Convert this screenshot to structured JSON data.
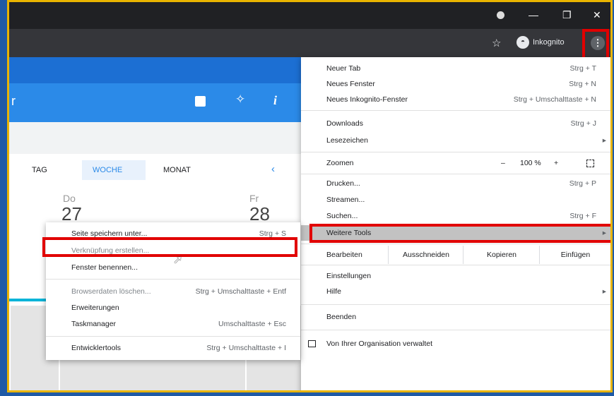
{
  "browser": {
    "incognito_label": "Inkognito",
    "window_controls": [
      "—",
      "❐",
      "✕"
    ]
  },
  "calendar": {
    "tabs": [
      "TAG",
      "WOCHE",
      "MONAT"
    ],
    "active_tab": "WOCHE",
    "days": [
      {
        "name": "Do",
        "num": "27"
      },
      {
        "name": "Fr",
        "num": "28"
      }
    ],
    "header_letter": "r"
  },
  "main_menu": {
    "items": [
      {
        "label": "Neuer Tab",
        "shortcut": "Strg + T"
      },
      {
        "label": "Neues Fenster",
        "shortcut": "Strg + N"
      },
      {
        "label": "Neues Inkognito-Fenster",
        "shortcut": "Strg + Umschalttaste + N"
      },
      {
        "label": "Downloads",
        "shortcut": "Strg + J"
      },
      {
        "label": "Lesezeichen",
        "shortcut": ""
      },
      {
        "label": "Drucken...",
        "shortcut": "Strg + P"
      },
      {
        "label": "Streamen...",
        "shortcut": ""
      },
      {
        "label": "Suchen...",
        "shortcut": "Strg + F"
      },
      {
        "label": "Weitere Tools",
        "shortcut": ""
      },
      {
        "label": "Einstellungen",
        "shortcut": ""
      },
      {
        "label": "Hilfe",
        "shortcut": ""
      },
      {
        "label": "Beenden",
        "shortcut": ""
      },
      {
        "label": "Von Ihrer Organisation verwaltet",
        "shortcut": ""
      }
    ],
    "zoom": {
      "label": "Zoomen",
      "minus": "–",
      "value": "100 %",
      "plus": "+"
    },
    "edit": {
      "label": "Bearbeiten",
      "cut": "Ausschneiden",
      "copy": "Kopieren",
      "paste": "Einfügen"
    }
  },
  "submenu": {
    "items": [
      {
        "label": "Seite speichern unter...",
        "shortcut": "Strg + S"
      },
      {
        "label": "Verknüpfung erstellen...",
        "shortcut": ""
      },
      {
        "label": "Fenster benennen...",
        "shortcut": ""
      },
      {
        "label": "Browserdaten löschen...",
        "shortcut": "Strg + Umschalttaste + Entf"
      },
      {
        "label": "Erweiterungen",
        "shortcut": ""
      },
      {
        "label": "Taskmanager",
        "shortcut": "Umschalttaste + Esc"
      },
      {
        "label": "Entwicklertools",
        "shortcut": "Strg + Umschalttaste + I"
      }
    ]
  },
  "colors": {
    "highlight": "#e10000",
    "frame": "#e9b400",
    "app_blue": "#2b8ae8"
  }
}
